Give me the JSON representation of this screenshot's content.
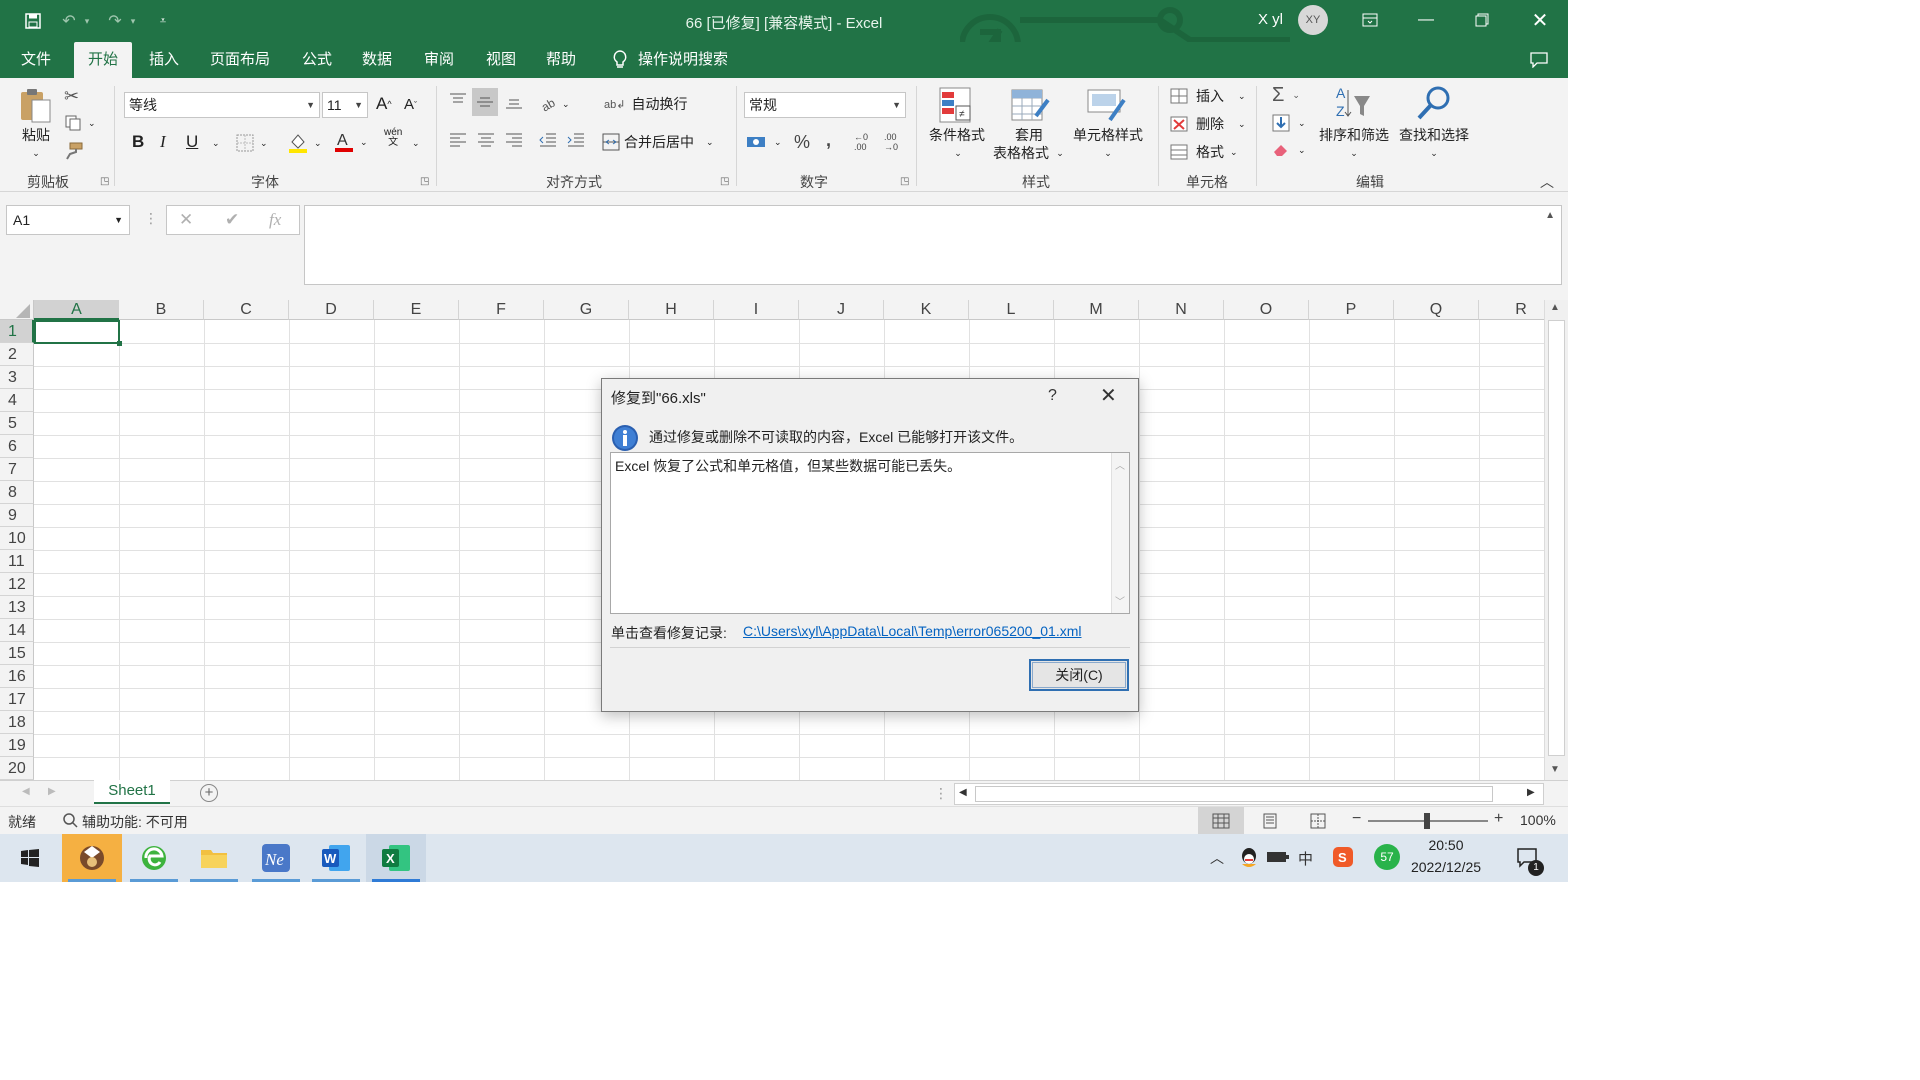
{
  "titlebar": {
    "title": "66 [已修复]  [兼容模式]  -  Excel",
    "user_name": "X yl",
    "avatar_initials": "XY"
  },
  "menu_tabs": [
    "文件",
    "开始",
    "插入",
    "页面布局",
    "公式",
    "数据",
    "审阅",
    "视图",
    "帮助",
    "操作说明搜索"
  ],
  "active_tab": "开始",
  "ribbon": {
    "clipboard": {
      "paste": "粘贴",
      "label": "剪贴板"
    },
    "font": {
      "name": "等线",
      "size": "11",
      "label": "字体",
      "bold": "B",
      "italic": "I",
      "underline": "U",
      "wen": "wén\n文"
    },
    "alignment": {
      "wrap": "自动换行",
      "merge": "合并后居中",
      "label": "对齐方式"
    },
    "number": {
      "format": "常规",
      "percent": "%",
      "comma": ",",
      "label": "数字"
    },
    "styles": {
      "conditional": "条件格式",
      "table_1": "套用",
      "table_2": "表格格式",
      "cell_styles": "单元格样式",
      "label": "样式"
    },
    "cells": {
      "insert": "插入",
      "delete": "删除",
      "format": "格式",
      "label": "单元格"
    },
    "editing": {
      "sort_filter": "排序和筛选",
      "find_select": "查找和选择",
      "label": "编辑"
    }
  },
  "formula_bar": {
    "name_box": "A1",
    "fx": "fx"
  },
  "columns": [
    "A",
    "B",
    "C",
    "D",
    "E",
    "F",
    "G",
    "H",
    "I",
    "J",
    "K",
    "L",
    "M",
    "N",
    "O",
    "P",
    "Q",
    "R"
  ],
  "rows": [
    "1",
    "2",
    "3",
    "4",
    "5",
    "6",
    "7",
    "8",
    "9",
    "10",
    "11",
    "12",
    "13",
    "14",
    "15",
    "16",
    "17",
    "18",
    "19",
    "20"
  ],
  "selected_cell": "A1",
  "sheet_tab": "Sheet1",
  "status": {
    "ready": "就绪",
    "accessibility": "辅助功能: 不可用",
    "zoom": "100%"
  },
  "dialog": {
    "title": "修复到\"66.xls\"",
    "help": "?",
    "message": "通过修复或删除不可读取的内容，Excel 已能够打开该文件。",
    "details": "Excel 恢复了公式和单元格值，但某些数据可能已丢失。",
    "log_label": "单击查看修复记录:",
    "log_link": "C:\\Users\\xyl\\AppData\\Local\\Temp\\error065200_01.xml",
    "close_button": "关闭(C)"
  },
  "taskbar": {
    "time": "20:50",
    "date": "2022/12/25",
    "ime": "中",
    "badge_count": "57",
    "notification_count": "1"
  },
  "colors": {
    "excel_green": "#217346",
    "link_blue": "#0563c1"
  }
}
